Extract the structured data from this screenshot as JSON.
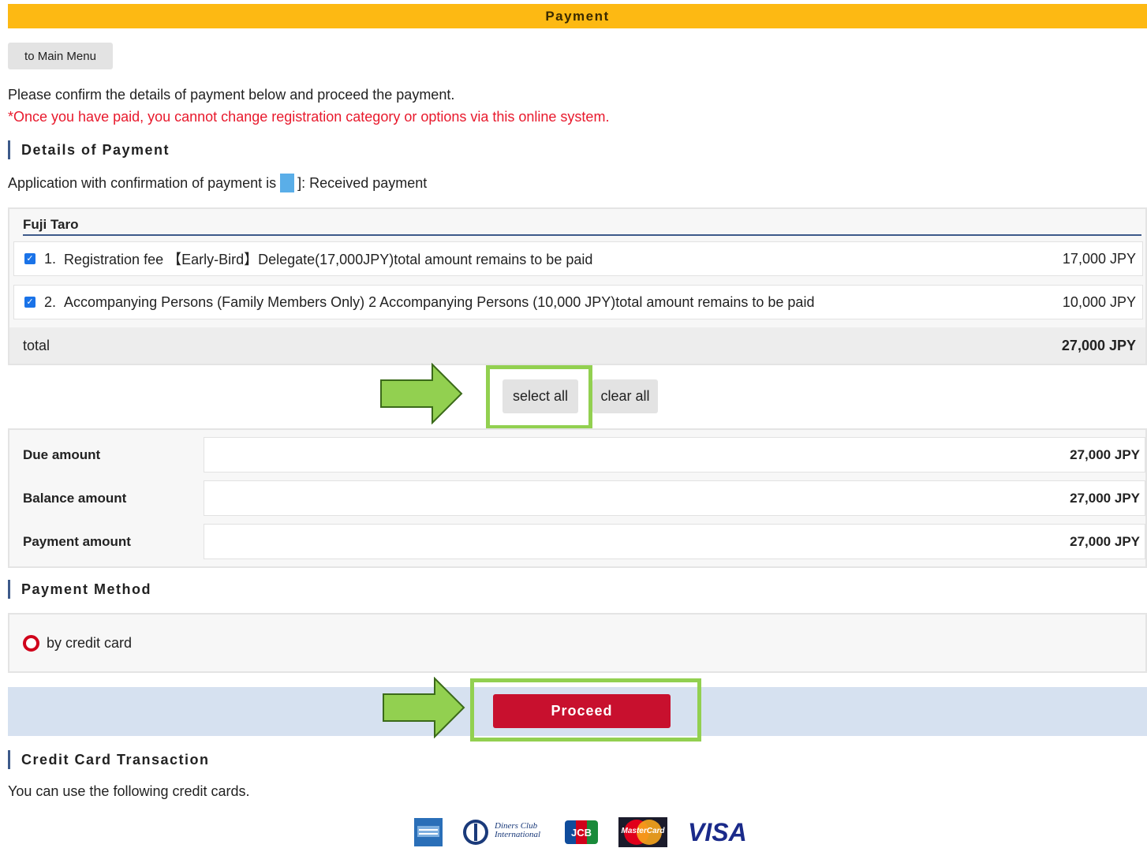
{
  "header": {
    "title": "Payment"
  },
  "nav": {
    "main_menu_label": "to Main Menu"
  },
  "intro": {
    "text": "Please confirm the details of payment below and proceed the payment.",
    "warning": "*Once you have paid, you cannot change registration category or options via this online system."
  },
  "details": {
    "section_title": "Details of Payment",
    "legend_prefix": "Application with confirmation of payment is",
    "legend_suffix": "]: Received payment",
    "legend_color": "#5aaee8",
    "person_name": "Fuji Taro",
    "items": [
      {
        "number": "1.",
        "description": "Registration fee 【Early-Bird】Delegate(17,000JPY)total amount remains to be paid",
        "amount": "17,000 JPY",
        "checked": true
      },
      {
        "number": "2.",
        "description": "Accompanying Persons (Family Members Only)  2 Accompanying Persons (10,000 JPY)total amount remains to be paid",
        "amount": "10,000 JPY",
        "checked": true
      }
    ],
    "total_label": "total",
    "total_amount": "27,000 JPY"
  },
  "selection": {
    "select_all_label": "select all",
    "clear_all_label": "clear all"
  },
  "amounts": {
    "rows": [
      {
        "label": "Due amount",
        "value": "27,000 JPY"
      },
      {
        "label": "Balance amount",
        "value": "27,000 JPY"
      },
      {
        "label": "Payment amount",
        "value": "27,000 JPY"
      }
    ]
  },
  "payment_method": {
    "section_title": "Payment Method",
    "option_label": "by credit card",
    "selected": true
  },
  "proceed": {
    "label": "Proceed"
  },
  "credit_cards": {
    "section_title": "Credit Card Transaction",
    "text": "You can use the following credit cards.",
    "brands": [
      "american-express",
      "diners-club",
      "jcb",
      "mastercard",
      "visa"
    ],
    "diners_text": "Diners Club International",
    "jcb_text": "JCB",
    "mastercard_text": "MasterCard",
    "visa_text": "VISA"
  },
  "colors": {
    "header": "#fdb913",
    "warning": "#e8192c",
    "accent_blue": "#3d5a8a",
    "proceed_button": "#c8102e",
    "proceed_bar": "#d6e1f0",
    "highlight_green": "#92d050"
  }
}
